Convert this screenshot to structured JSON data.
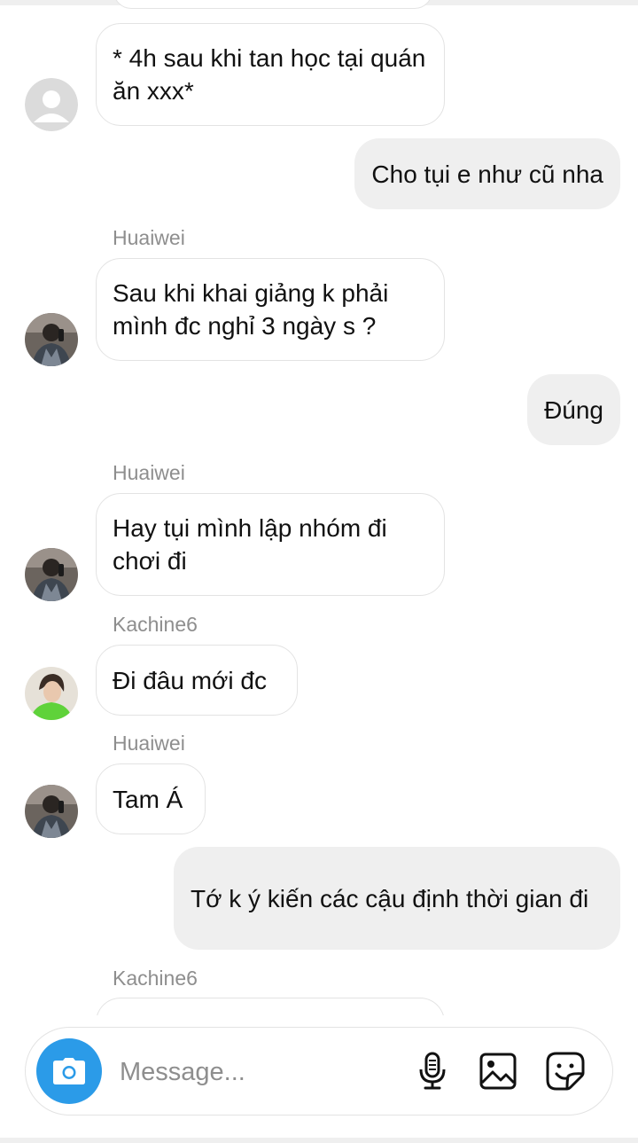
{
  "messages": [
    {
      "direction": "in",
      "sender": "",
      "avatar": "default",
      "text": "* 4h sau khi tan học tại quán ăn xxx*"
    },
    {
      "direction": "out",
      "text": "Cho tụi e như cũ nha"
    },
    {
      "direction": "in",
      "sender": "Huaiwei",
      "avatar": "huaiwei",
      "text": "Sau khi khai giảng k phải mình đc nghỉ 3 ngày s ?"
    },
    {
      "direction": "out",
      "text": "Đúng"
    },
    {
      "direction": "in",
      "sender": "Huaiwei",
      "avatar": "huaiwei",
      "text": "Hay tụi mình lập nhóm đi chơi đi"
    },
    {
      "direction": "in",
      "sender": "Kachine6",
      "avatar": "kachine6",
      "text": "Đi đâu mới đc"
    },
    {
      "direction": "in",
      "sender": "Huaiwei",
      "avatar": "huaiwei",
      "text": "Tam Á"
    },
    {
      "direction": "out",
      "text": "Tớ k ý kiến các cậu định thời gian đi"
    },
    {
      "direction": "in",
      "sender": "Kachine6",
      "avatar": "kachine6",
      "text": ""
    }
  ],
  "composer": {
    "placeholder": "Message...",
    "value": "",
    "camera_icon": "camera-icon",
    "mic_icon": "microphone-icon",
    "gallery_icon": "image-icon",
    "sticker_icon": "sticker-icon"
  },
  "colors": {
    "accent": "#2b9be8",
    "outgoing_bubble": "#efefef",
    "incoming_border": "#e3e3e3",
    "sender_name": "#8e8e8e"
  }
}
